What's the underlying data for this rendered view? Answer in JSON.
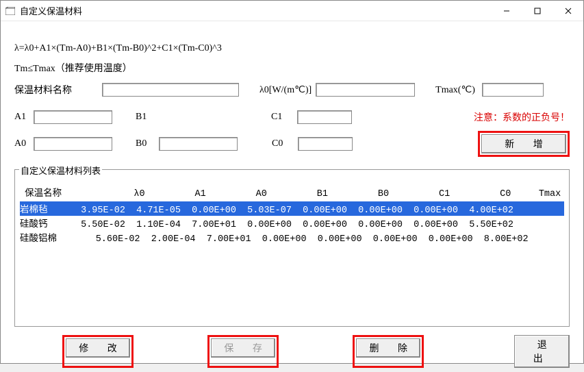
{
  "window": {
    "title": "自定义保温材料"
  },
  "formula": "λ=λ0+A1×(Tm-A0)+B1×(Tm-B0)^2+C1×(Tm-C0)^3",
  "hint": "Tm≤Tmax（推荐使用温度）",
  "labels": {
    "name": "保温材料名称",
    "lambda0": "λ0[W/(m℃)]",
    "tmax": "Tmax(℃)",
    "a1": "A1",
    "b1": "B1",
    "c1": "C1",
    "a0": "A0",
    "b0": "B0",
    "c0": "C0",
    "warn": "注意：系数的正负号！"
  },
  "inputs": {
    "name": "",
    "lambda0": "",
    "tmax": "",
    "a1": "",
    "b1": "",
    "c1": "",
    "a0": "",
    "b0": "",
    "c0": ""
  },
  "buttons": {
    "add": "新 增",
    "modify": "修 改",
    "save": "保 存",
    "delete": "删 除",
    "exit": "退 出"
  },
  "list": {
    "title": "自定义保温材料列表",
    "headers": [
      "保温名称",
      "λ0",
      "A1",
      "A0",
      "B1",
      "B0",
      "C1",
      "C0",
      "Tmax"
    ],
    "rows": [
      {
        "selected": true,
        "cells": [
          "岩棉毡",
          "3.95E-02",
          "4.71E-05",
          "0.00E+00",
          "5.03E-07",
          "0.00E+00",
          "0.00E+00",
          "0.00E+00",
          "4.00E+02"
        ]
      },
      {
        "selected": false,
        "cells": [
          "硅酸钙",
          "5.50E-02",
          "1.10E-04",
          "7.00E+01",
          "0.00E+00",
          "0.00E+00",
          "0.00E+00",
          "0.00E+00",
          "5.50E+02"
        ]
      },
      {
        "selected": false,
        "cells": [
          "硅酸铝棉",
          "5.60E-02",
          "2.00E-04",
          "7.00E+01",
          "0.00E+00",
          "0.00E+00",
          "0.00E+00",
          "0.00E+00",
          "8.00E+02"
        ]
      }
    ]
  }
}
